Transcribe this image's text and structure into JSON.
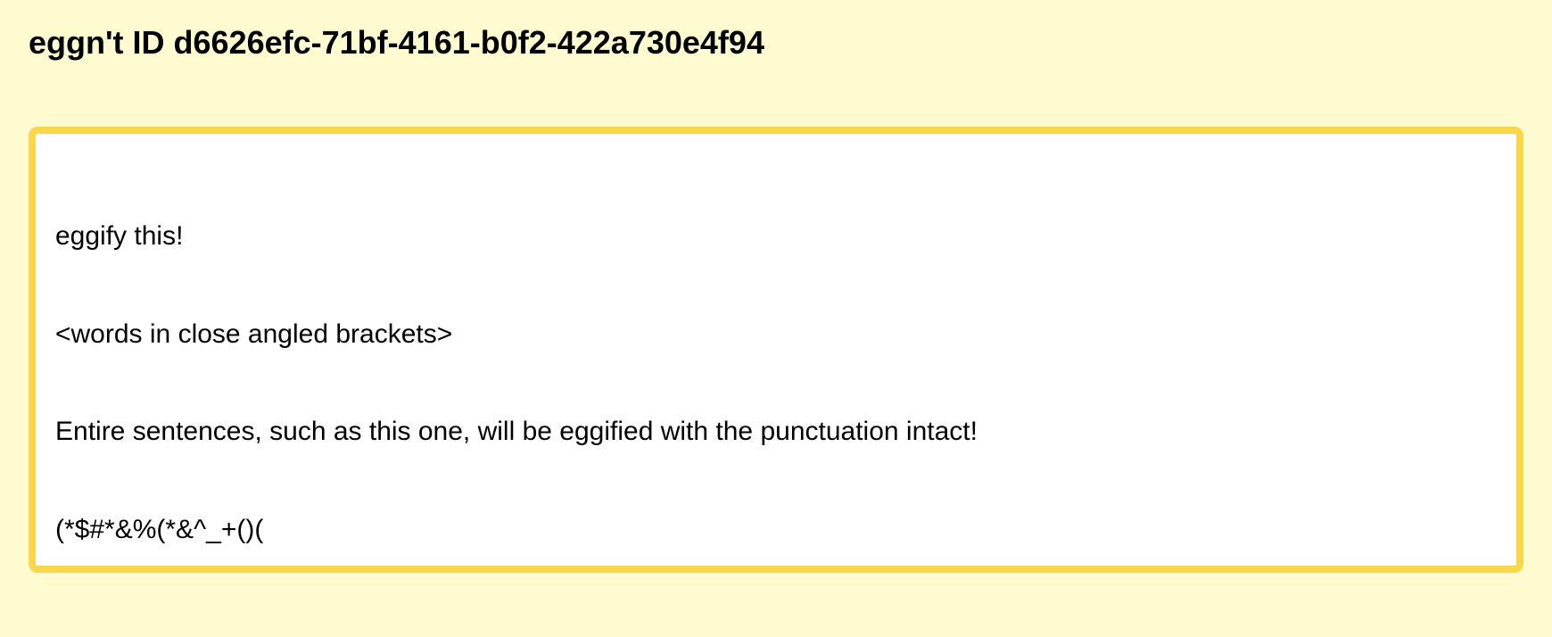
{
  "header": {
    "title": "eggn't ID d6626efc-71bf-4161-b0f2-422a730e4f94"
  },
  "editor": {
    "lines": [
      "eggify this!",
      "<words in close angled brackets>",
      "Entire sentences, such as this one, will be eggified with the punctuation intact!",
      "(*$#*&%(*&^_+()("
    ]
  },
  "colors": {
    "background": "#fffbd1",
    "accent_border": "#f9d74a",
    "editor_background": "#ffffff",
    "text": "#000000"
  }
}
